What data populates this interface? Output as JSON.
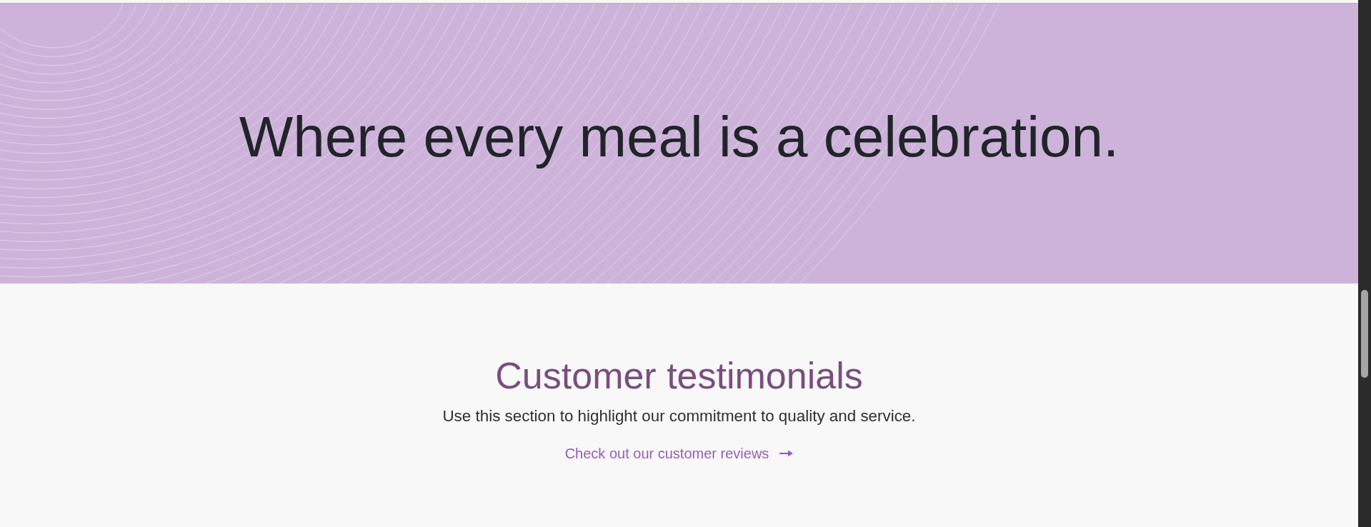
{
  "hero": {
    "heading": "Where every meal is a celebration."
  },
  "testimonials": {
    "heading": "Customer testimonials",
    "text": "Use this section to highlight our commitment to quality and service.",
    "link": {
      "label": "Check out our customer reviews"
    }
  }
}
